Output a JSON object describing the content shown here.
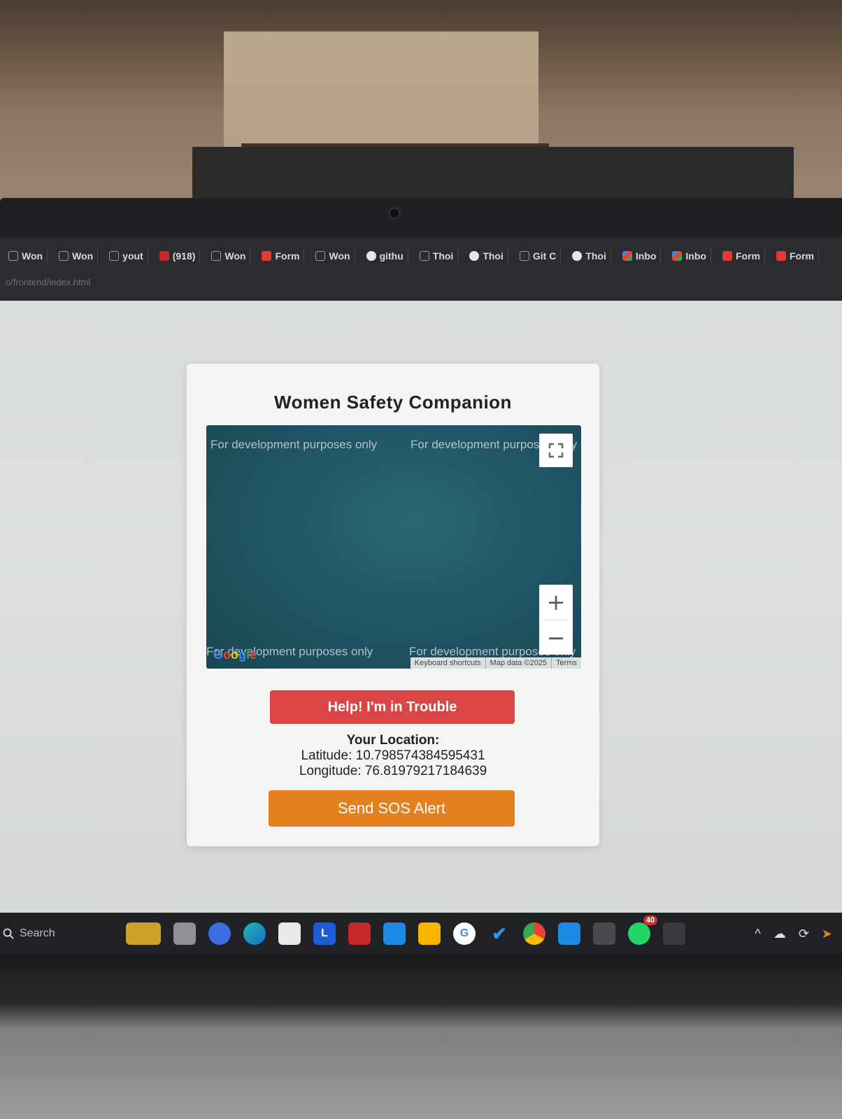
{
  "browser": {
    "bookmarks": [
      {
        "icon": "doc",
        "label": "Won"
      },
      {
        "icon": "doc",
        "label": "Won"
      },
      {
        "icon": "doc",
        "label": "yout"
      },
      {
        "icon": "yt",
        "label": "(918)"
      },
      {
        "icon": "doc",
        "label": "Won"
      },
      {
        "icon": "fm",
        "label": "Form"
      },
      {
        "icon": "doc",
        "label": "Won"
      },
      {
        "icon": "gh",
        "label": "githu"
      },
      {
        "icon": "doc",
        "label": "Thoi"
      },
      {
        "icon": "gh",
        "label": "Thoi"
      },
      {
        "icon": "doc",
        "label": "Git C"
      },
      {
        "icon": "gh",
        "label": "Thoi"
      },
      {
        "icon": "gm",
        "label": "Inbo"
      },
      {
        "icon": "gm",
        "label": "Inbo"
      },
      {
        "icon": "fm",
        "label": "Form"
      },
      {
        "icon": "fm",
        "label": "Form"
      }
    ],
    "address": "o/frontend/index.html"
  },
  "app": {
    "title": "Women Safety Companion",
    "map": {
      "watermark": "For development purposes only",
      "google_logo": "Google",
      "attribution": [
        "Keyboard shortcuts",
        "Map data ©2025",
        "Terms"
      ],
      "zoom_in": "+",
      "zoom_out": "−"
    },
    "help_button": "Help! I'm in Trouble",
    "location": {
      "heading": "Your Location:",
      "latitude": "Latitude: 10.798574384595431",
      "longitude": "Longitude: 76.81979217184639"
    },
    "sos_button": "Send SOS Alert"
  },
  "taskbar": {
    "search_label": "Search",
    "whatsapp_badge": "40",
    "colors": {
      "help": "#dc4545",
      "sos": "#e5801e",
      "map": "#1f5462"
    }
  }
}
